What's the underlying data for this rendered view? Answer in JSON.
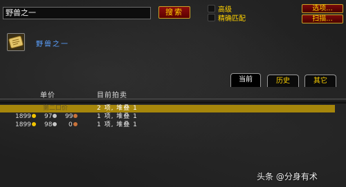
{
  "search": {
    "value": "野兽之一",
    "button_label": "搜索"
  },
  "options": [
    {
      "label": "高级"
    },
    {
      "label": "精确匹配"
    }
  ],
  "side_buttons": {
    "options_label": "选项...",
    "scan_label": "扫描..."
  },
  "item": {
    "name": "野兽之一",
    "icon": "golden-tablet-icon"
  },
  "tabs": {
    "current": "当前",
    "history": "历史",
    "other": "其它"
  },
  "columns": {
    "unit_price": "单价",
    "current_auctions": "目前拍卖"
  },
  "rows": [
    {
      "price_text": "第二口价",
      "gold": "",
      "silver": "",
      "copper": "",
      "qty": "2 项, 堆叠 1",
      "selected": true
    },
    {
      "price_text": "",
      "gold": "1899",
      "silver": "97",
      "copper": "99",
      "qty": "1 项, 堆叠 1",
      "selected": false
    },
    {
      "price_text": "",
      "gold": "1899",
      "silver": "98",
      "copper": "0",
      "qty": "1 项, 堆叠 1",
      "selected": false
    }
  ],
  "watermark": "头条 @分身有术",
  "colors": {
    "gold_text": "#ffd200",
    "highlight": "#a6860b",
    "item_name": "#5aa0ff",
    "button_red": "#7a0b0b"
  }
}
